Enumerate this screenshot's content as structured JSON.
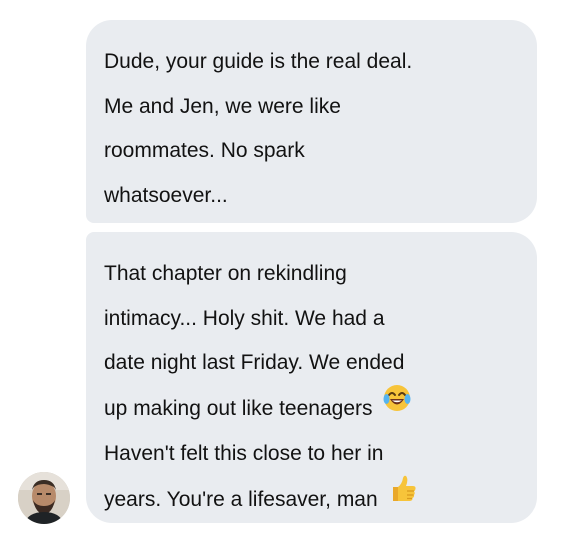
{
  "messages": [
    {
      "lines": [
        "Dude, your guide is the real deal.",
        "Me and Jen, we were like",
        "roommates. No spark",
        "whatsoever..."
      ]
    },
    {
      "lines": [
        "That chapter on rekindling",
        "intimacy... Holy shit. We had a",
        "date night last Friday. We ended",
        "up making out like teenagers",
        "Haven't felt this close to her in",
        "years. You're a lifesaver, man"
      ],
      "emojis": {
        "line_4": "laughing-tears-emoji",
        "line_6": "thumbs-up-emoji"
      }
    }
  ],
  "sender": {
    "avatar_icon": "avatar"
  },
  "colors": {
    "bubble": "#e9ecf0",
    "text": "#121212",
    "emoji": "#f7c43a"
  }
}
